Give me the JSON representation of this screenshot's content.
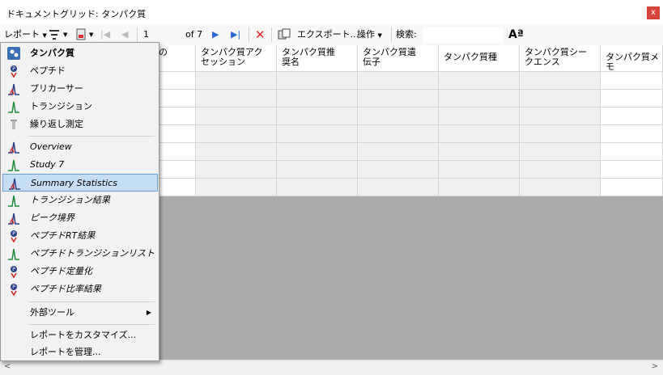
{
  "window": {
    "title": "ドキュメントグリッド: タンパク質",
    "close_label": "x"
  },
  "toolbar": {
    "reports_label": "レポート",
    "page_value": "1",
    "page_of": "of 7",
    "export_label": "エクスポート...",
    "actions_label": "操作",
    "search_label": "検索:",
    "font_icon_label": "Aª"
  },
  "grid": {
    "columns": [
      "の",
      "タンパク質アク\nセッション",
      "タンパク質推\n奨名",
      "タンパク質遺\n伝子",
      "タンパク質種",
      "タンパク質シー\nクエンス",
      "タンパク質メモ"
    ]
  },
  "menu": {
    "items": [
      {
        "label": "タンパク質",
        "icon": "protein-icon"
      },
      {
        "label": "ペプチド",
        "icon": "peptide-icon"
      },
      {
        "label": "プリカーサー",
        "icon": "precursor-icon"
      },
      {
        "label": "トランジション",
        "icon": "transition-icon"
      },
      {
        "label": "繰り返し測定",
        "icon": "replicate-icon"
      },
      {
        "label": "Overview",
        "icon": "precursor-icon"
      },
      {
        "label": "Study 7",
        "icon": "transition-icon"
      },
      {
        "label": "Summary Statistics",
        "icon": "precursor-icon"
      },
      {
        "label": "トランジション結果",
        "icon": "transition-icon"
      },
      {
        "label": "ピーク境界",
        "icon": "precursor-icon"
      },
      {
        "label": "ペプチドRT結果",
        "icon": "peptide-icon"
      },
      {
        "label": "ペプチドトランジションリスト",
        "icon": "transition-icon"
      },
      {
        "label": "ペプチド定量化",
        "icon": "peptide-icon"
      },
      {
        "label": "ペプチド比率結果",
        "icon": "peptide-icon"
      },
      {
        "label": "外部ツール",
        "icon": ""
      },
      {
        "label": "レポートをカスタマイズ...",
        "icon": ""
      },
      {
        "label": "レポートを管理...",
        "icon": ""
      }
    ]
  }
}
